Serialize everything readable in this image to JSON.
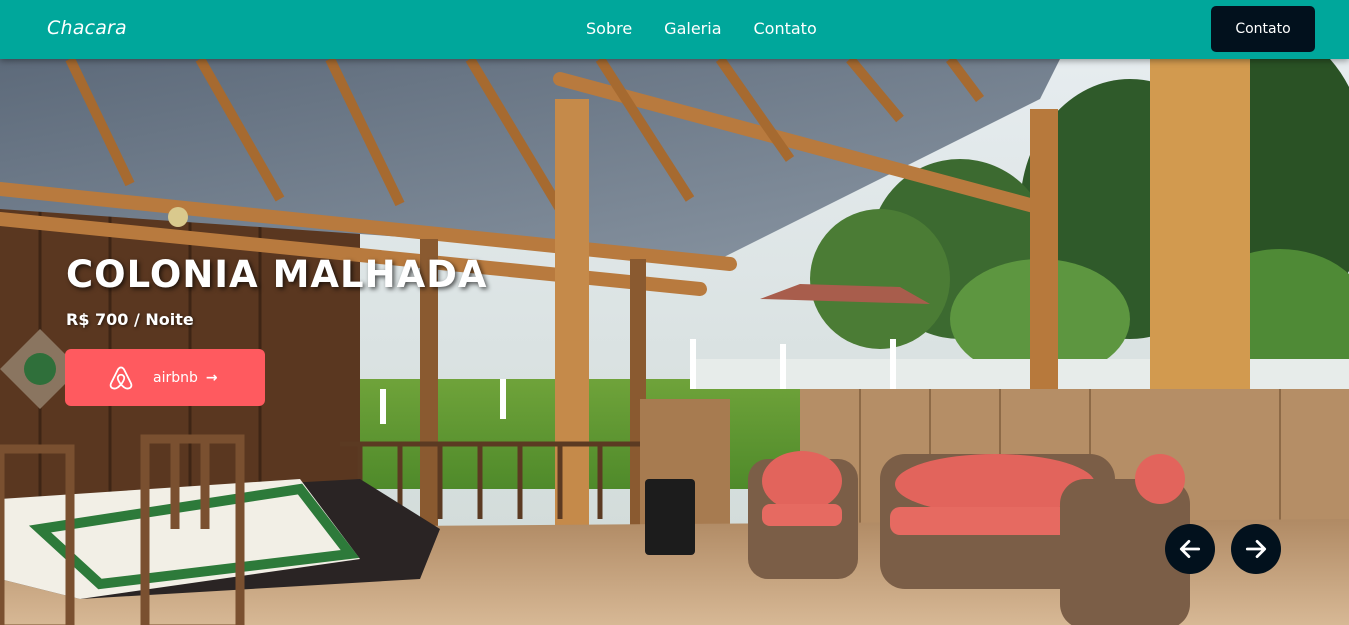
{
  "navbar": {
    "brand": "Chacara",
    "links": [
      "Sobre",
      "Galeria",
      "Contato"
    ],
    "contact_button": "Contato",
    "background": "#00a79b"
  },
  "hero": {
    "title": "COLONIA MALHADA",
    "price": "R$ 700 / Noite",
    "airbnb_button": {
      "label": "airbnb",
      "icon": "airbnb-logo-icon",
      "arrow": "→",
      "color": "#ff5a5f"
    },
    "carousel": {
      "prev_icon": "arrow-left-icon",
      "next_icon": "arrow-right-icon"
    }
  }
}
